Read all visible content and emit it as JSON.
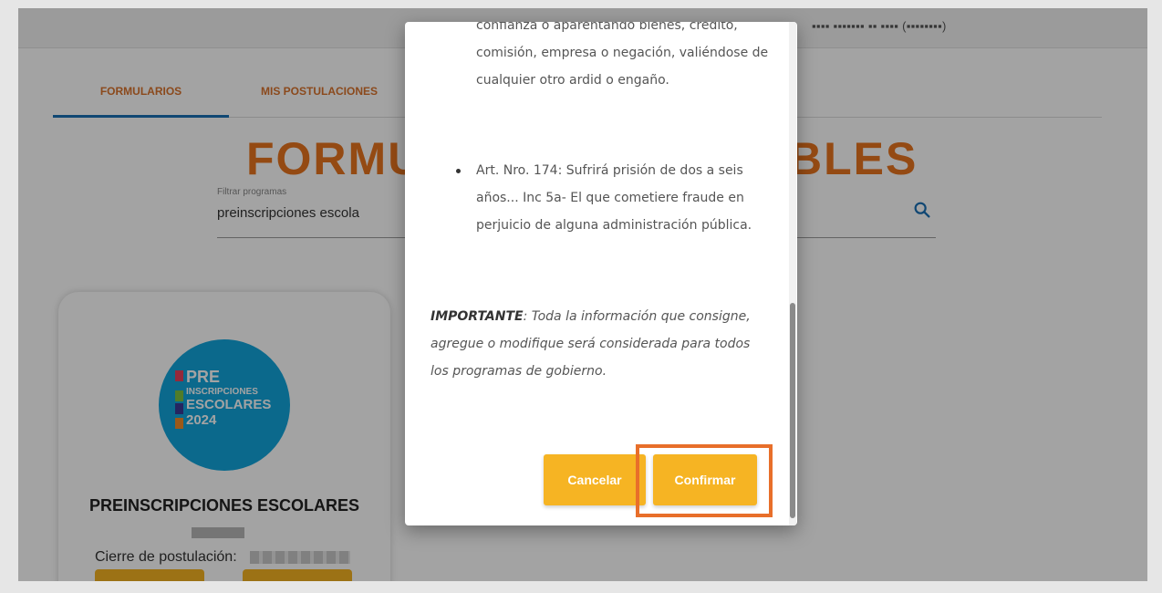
{
  "header": {
    "user_text": "▪▪▪▪ ▪▪▪▪▪▪▪ ▪▪ ▪▪▪▪ (▪▪▪▪▪▪▪▪)"
  },
  "tabs": [
    {
      "label": "FORMULARIOS",
      "active": true
    },
    {
      "label": "MIS POSTULACIONES",
      "active": false
    }
  ],
  "main": {
    "title_left": "FORMU",
    "title_right": "BLES"
  },
  "filter": {
    "label": "Filtrar programas",
    "value": "preinscripciones escola",
    "icon": "search-icon"
  },
  "card": {
    "logo_lines": [
      "PRE",
      "INSCRIPCIONES",
      "ESCOLARES",
      "2024"
    ],
    "title": "PREINSCRIPCIONES ESCOLARES",
    "cierre_label": "Cierre de postulación:"
  },
  "modal": {
    "para1": "confianza o aparentando bienes, crédito, comisión, empresa o negación, valiéndose de cualquier otro ardid o engaño.",
    "bullet": "Art. Nro. 174: Sufrirá prisión de dos a seis años... Inc 5a- El que cometiere fraude en perjuicio de alguna administración pública.",
    "important_label": "IMPORTANTE",
    "important_text": ": Toda la información que consigne, agregue o modifique será considerada para todos los programas de gobierno.",
    "cancel_label": "Cancelar",
    "confirm_label": "Confirmar"
  },
  "colors": {
    "accent_orange": "#e8741f",
    "button_yellow": "#f6b423",
    "tab_indicator": "#1a6fb5",
    "highlight": "#e86f2a",
    "logo_blue": "#12a4dc"
  }
}
